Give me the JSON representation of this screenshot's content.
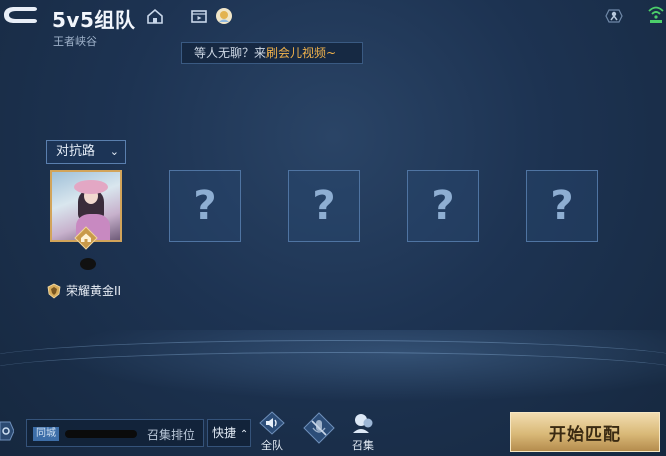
{
  "header": {
    "title": "5v5组队",
    "subtitle": "王者峡谷"
  },
  "video_tip": {
    "prefix": "等人无聊？来",
    "highlight": "刷会儿视频~"
  },
  "lane_select": {
    "value": "对抗路"
  },
  "team": {
    "player": {
      "rank": "荣耀黄金II"
    },
    "empty_slot_symbol": "?"
  },
  "bottom": {
    "chat_tag": "同城",
    "chat_action": "召集排位",
    "quick_label": "快捷",
    "all_team_label": "全队",
    "summon_label": "召集",
    "start_label": "开始匹配"
  },
  "colors": {
    "accent_gold": "#d9b978",
    "highlight_orange": "#f2b34c",
    "slot_border": "#4f74a2"
  },
  "icons": [
    "back-icon",
    "home-icon",
    "video-icon",
    "lobby-avatar-icon",
    "settings-figure-icon",
    "wifi-icon",
    "house-owner-icon",
    "rank-badge-icon",
    "speaker-icon",
    "mic-off-icon",
    "summon-icon"
  ]
}
